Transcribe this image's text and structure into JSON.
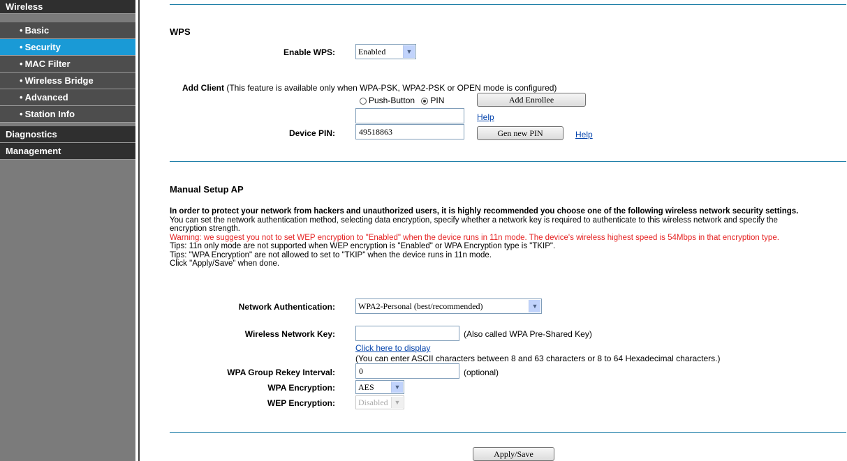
{
  "sidebar": {
    "items": [
      {
        "label": "Wireless",
        "level": "top"
      },
      {
        "label": "Basic",
        "level": "sub"
      },
      {
        "label": "Security",
        "level": "sub",
        "active": true
      },
      {
        "label": "MAC Filter",
        "level": "sub"
      },
      {
        "label": "Wireless Bridge",
        "level": "sub"
      },
      {
        "label": "Advanced",
        "level": "sub"
      },
      {
        "label": "Station Info",
        "level": "sub"
      },
      {
        "label": "Diagnostics",
        "level": "top"
      },
      {
        "label": "Management",
        "level": "top"
      }
    ],
    "bullet": "•"
  },
  "wps": {
    "title": "WPS",
    "enable_label": "Enable WPS:",
    "enable_value": "Enabled",
    "add_client_bold": "Add Client",
    "add_client_note": " (This feature is available only when WPA-PSK, WPA2-PSK or OPEN mode is configured)",
    "radio_push": "Push-Button",
    "radio_pin": "PIN",
    "add_enrollee": "Add Enrollee",
    "pin_input_value": "",
    "help1": "Help",
    "device_pin_label": "Device PIN:",
    "device_pin_value": "49518863",
    "gen_pin": "Gen new PIN",
    "help2": "Help"
  },
  "manual": {
    "title": "Manual Setup AP",
    "intro_bold": "In order to protect your network from hackers and unauthorized users, it is highly recommended you choose one of the following wireless network security settings.",
    "intro_line2": "You can set the network authentication method, selecting data encryption, specify whether a network key is required to authenticate to this wireless network and specify the",
    "intro_line3": "encryption strength.",
    "warning": "Warning: we suggest you not to set WEP encryption to \"Enabled\" when the device runs in 11n mode. The device's wireless highest speed is 54Mbps in that encryption type.",
    "tips1": "Tips: 11n only mode are not supported when WEP encryption is \"Enabled\" or WPA Encryption type is \"TKIP\".",
    "tips2": "Tips: \"WPA Encryption\" are not allowed to set to \"TKIP\" when the device runs in 11n mode.",
    "click_apply": "Click \"Apply/Save\" when done.",
    "auth_label": "Network Authentication:",
    "auth_value": "WPA2-Personal (best/recommended)",
    "key_label": "Wireless Network Key:",
    "key_value": "",
    "key_note": "(Also called WPA Pre-Shared Key)",
    "click_display": "Click here to display",
    "key_hint": "(You can enter ASCII characters between 8 and 63 characters or 8 to 64 Hexadecimal characters.)",
    "rekey_label": "WPA Group Rekey Interval:",
    "rekey_value": "0",
    "rekey_note": "(optional)",
    "wpa_enc_label": "WPA Encryption:",
    "wpa_enc_value": "AES",
    "wep_enc_label": "WEP Encryption:",
    "wep_enc_value": "Disabled",
    "apply": "Apply/Save"
  },
  "colors": {
    "sidebar_top": "#2f2f2f",
    "sidebar_sub": "#4d4d4d",
    "active": "#1a9ad6",
    "rule": "#1f7fa8",
    "warning": "#e52222",
    "link": "#0645ad"
  },
  "icons": {
    "dropdown": "chevron-down-icon"
  }
}
